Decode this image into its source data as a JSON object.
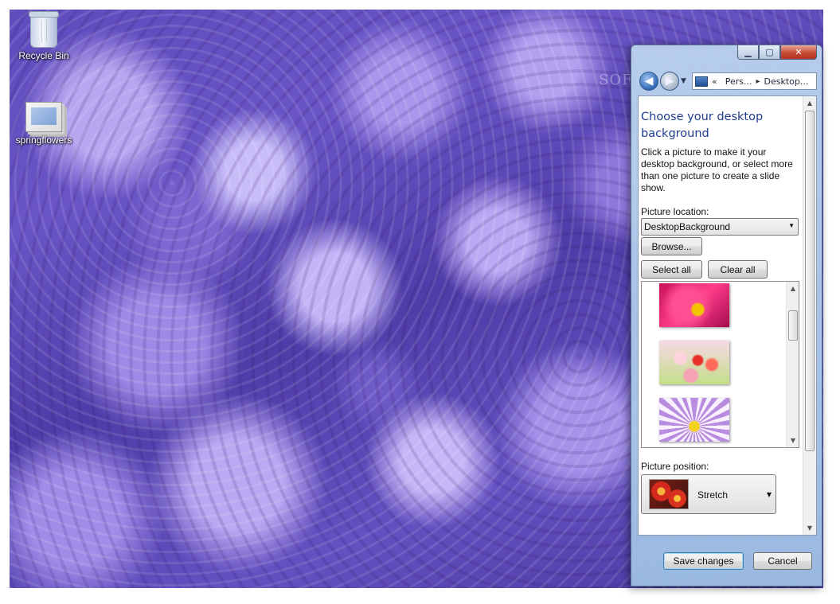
{
  "desktop": {
    "icons": [
      {
        "label": "Recycle Bin",
        "icon": "recycle-bin-icon"
      },
      {
        "label": "springflowers",
        "icon": "image-folder-icon"
      }
    ]
  },
  "window": {
    "caption_buttons": {
      "minimize": "▁",
      "maximize": "▢",
      "close": "✕"
    },
    "address": {
      "crumb_prefix": "«",
      "crumbs": [
        "Pers...",
        "Desktop..."
      ],
      "separator": "▸"
    },
    "heading": "Choose your desktop background",
    "description": "Click a picture to make it your desktop background, or select more than one picture to create a slide show.",
    "picture_location": {
      "label": "Picture location:",
      "value": "DesktopBackground"
    },
    "buttons": {
      "browse": "Browse...",
      "select_all": "Select all",
      "clear_all": "Clear all"
    },
    "thumbnails": [
      "pink-flower-bee",
      "tulip-field",
      "yellow-purple-flower"
    ],
    "picture_position": {
      "label": "Picture position:",
      "value": "Stretch"
    },
    "footer": {
      "save": "Save changes",
      "cancel": "Cancel"
    }
  },
  "watermark": "SOFTPEDIA",
  "colors": {
    "heading": "#1e3c8c",
    "accent": "#3c7fb1"
  }
}
